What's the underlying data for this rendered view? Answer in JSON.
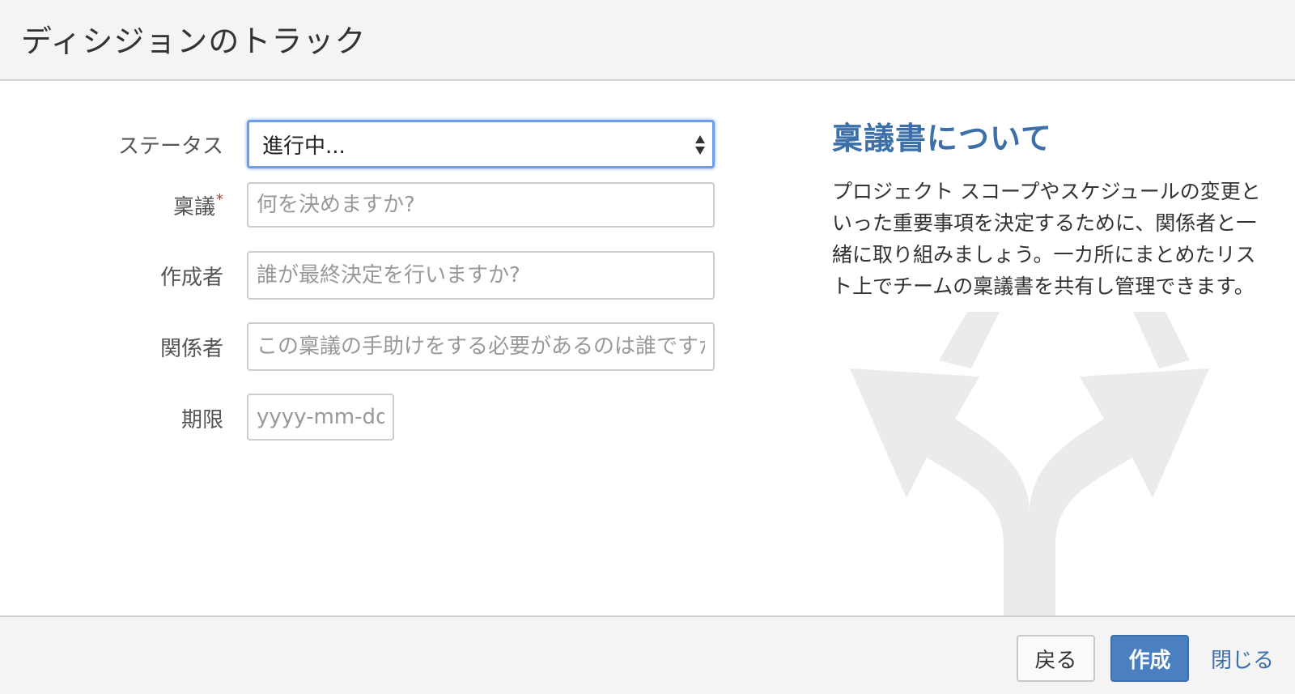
{
  "header": {
    "title": "ディシジョンのトラック"
  },
  "form": {
    "status": {
      "label": "ステータス",
      "value": "進行中..."
    },
    "decision": {
      "label": "稟議",
      "required_mark": "*",
      "placeholder": "何を決めますか?"
    },
    "owner": {
      "label": "作成者",
      "placeholder": "誰が最終決定を行いますか?"
    },
    "stakeholders": {
      "label": "関係者",
      "placeholder": "この稟議の手助けをする必要があるのは誰ですか?"
    },
    "due_date": {
      "label": "期限",
      "placeholder": "yyyy-mm-dd"
    }
  },
  "info": {
    "title": "稟議書について",
    "body": "プロジェクト スコープやスケジュールの変更といった重要事項を決定するために、関係者と一緒に取り組みましょう。一カ所にまとめたリスト上でチームの稟議書を共有し管理できます。"
  },
  "footer": {
    "back_label": "戻る",
    "create_label": "作成",
    "close_label": "閉じる"
  },
  "colors": {
    "accent": "#3d6fa8",
    "primary_button": "#4a7fc0",
    "focus_ring": "#6d9eeb",
    "required": "#c0392b"
  },
  "icons": {
    "background": "split-arrows-icon",
    "select": "select-arrows-icon"
  }
}
